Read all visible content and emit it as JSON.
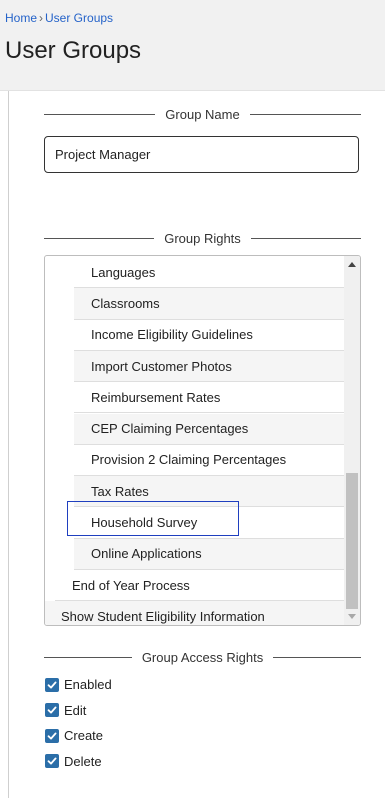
{
  "breadcrumb": {
    "home": "Home",
    "separator": "›",
    "current": "User Groups"
  },
  "page_title": "User Groups",
  "group_name": {
    "legend": "Group Name",
    "value": "Project Manager"
  },
  "group_rights": {
    "legend": "Group Rights",
    "selected_item": "Household Survey",
    "items": [
      {
        "label": "Languages",
        "level": 2
      },
      {
        "label": "Classrooms",
        "level": 2
      },
      {
        "label": "Income Eligibility Guidelines",
        "level": 2
      },
      {
        "label": "Import Customer Photos",
        "level": 2
      },
      {
        "label": "Reimbursement Rates",
        "level": 2
      },
      {
        "label": "CEP Claiming Percentages",
        "level": 2
      },
      {
        "label": "Provision 2 Claiming Percentages",
        "level": 2
      },
      {
        "label": "Tax Rates",
        "level": 2
      },
      {
        "label": "Household Survey",
        "level": 2
      },
      {
        "label": "Online Applications",
        "level": 2
      },
      {
        "label": "End of Year Process",
        "level": 1
      },
      {
        "label": "Show Student Eligibility Information",
        "level": 0
      }
    ]
  },
  "group_access_rights": {
    "legend": "Group Access Rights",
    "options": [
      {
        "label": "Enabled",
        "checked": true
      },
      {
        "label": "Edit",
        "checked": true
      },
      {
        "label": "Create",
        "checked": true
      },
      {
        "label": "Delete",
        "checked": true
      }
    ]
  },
  "colors": {
    "link": "#2563c9",
    "checkbox": "#2b6ea8",
    "selection": "#1f3fbf",
    "header_bg": "#f1f1f1"
  },
  "icons": {
    "check": "check-icon",
    "scroll_up": "arrow-up-icon",
    "scroll_down": "arrow-down-icon"
  }
}
